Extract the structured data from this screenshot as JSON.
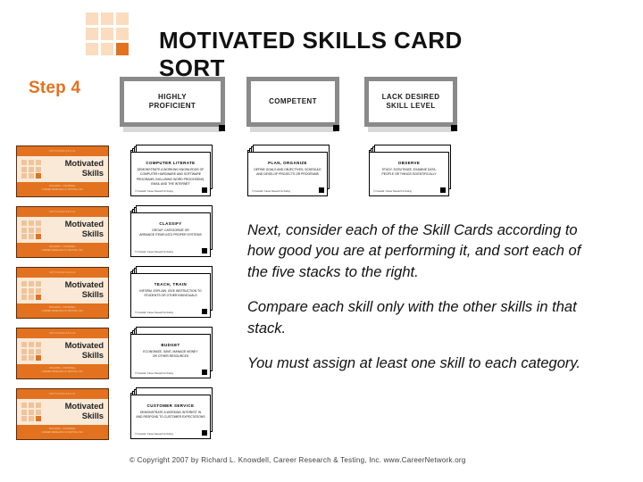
{
  "slide": {
    "step_label": "Step 4",
    "title": "MOTIVATED SKILLS CARD SORT",
    "copyright": "© Copyright 2007 by Richard L. Knowdell, Career Research & Testing, Inc. www.CareerNetwork.org"
  },
  "colors": {
    "accent_orange": "#E2721F",
    "logo_light": "#FBDCBE",
    "card_band": "#FBE9D8",
    "monitor_gray": "#8A8A8A"
  },
  "categories": [
    {
      "label": "HIGHLY\nPROFICIENT"
    },
    {
      "label": "COMPETENT"
    },
    {
      "label": "LACK DESIRED\nSKILL LEVEL"
    }
  ],
  "motivated_skills_cards": [
    {
      "micro_top": "MOTIVATED SKILLS",
      "title_line1": "Motivated",
      "title_line2": "Skills",
      "micro_bottom": "RICHARD L. KNOWDELL\nCAREER RESEARCH & TESTING, INC."
    },
    {
      "micro_top": "MOTIVATED SKILLS",
      "title_line1": "Motivated",
      "title_line2": "Skills",
      "micro_bottom": "RICHARD L. KNOWDELL\nCAREER RESEARCH & TESTING, INC."
    },
    {
      "micro_top": "MOTIVATED SKILLS",
      "title_line1": "Motivated",
      "title_line2": "Skills",
      "micro_bottom": "RICHARD L. KNOWDELL\nCAREER RESEARCH & TESTING, INC."
    },
    {
      "micro_top": "MOTIVATED SKILLS",
      "title_line1": "Motivated",
      "title_line2": "Skills",
      "micro_bottom": "RICHARD L. KNOWDELL\nCAREER RESEARCH & TESTING, INC."
    },
    {
      "micro_top": "MOTIVATED SKILLS",
      "title_line1": "Motivated",
      "title_line2": "Skills",
      "micro_bottom": "RICHARD L. KNOWDELL\nCAREER RESEARCH & TESTING, INC."
    }
  ],
  "skill_stacks_middle": [
    {
      "title": "COMPUTER LITERATE",
      "body": "DEMONSTRATE A WORKING KNOWLEDGE OF\nCOMPUTER HARDWARE AND SOFTWARE\nPROGRAMS, INCLUDING WORD PROCESSING,\nEMAIL AND THE INTERNET",
      "footer": "© Knowdell / Career Research & Testing"
    },
    {
      "title": "CLASSIFY",
      "body": "GROUP, CATEGORIZE OR\nARRANGE ITEMS INTO PROPER SYSTEMS",
      "footer": "© Knowdell / Career Research & Testing"
    },
    {
      "title": "TEACH, TRAIN",
      "body": "INFORM, EXPLAIN, GIVE INSTRUCTION TO\nSTUDENTS OR OTHER INDIVIDUALS",
      "footer": "© Knowdell / Career Research & Testing"
    },
    {
      "title": "BUDGET",
      "body": "ECONOMIZE, SAVE, MANAGE MONEY\nOR OTHER RESOURCES",
      "footer": "© Knowdell / Career Research & Testing"
    },
    {
      "title": "CUSTOMER SERVICE",
      "body": "DEMONSTRATE A WORKING INTEREST IN\nAND RESPOND TO CUSTOMER EXPECTATIONS",
      "footer": "© Knowdell / Career Research & Testing"
    }
  ],
  "skill_stacks_right": [
    {
      "title": "PLAN, ORGANIZE",
      "body": "DEFINE GOALS AND OBJECTIVES, SCHEDULE\nAND DEVELOP PROJECTS OR PROGRAMS",
      "footer": "© Knowdell / Career Research & Testing"
    },
    {
      "title": "OBSERVE",
      "body": "STUDY, SCRUTINIZE, EXAMINE DATA,\nPEOPLE OR THINGS SCIENTIFICALLY",
      "footer": "© Knowdell / Career Research & Testing"
    }
  ],
  "instructions": [
    "Next, consider each of the Skill Cards according to how good you are at performing it, and sort each of the five stacks to the right.",
    "Compare each skill only with the other skills in that stack.",
    "You must assign at least one skill to each category."
  ]
}
